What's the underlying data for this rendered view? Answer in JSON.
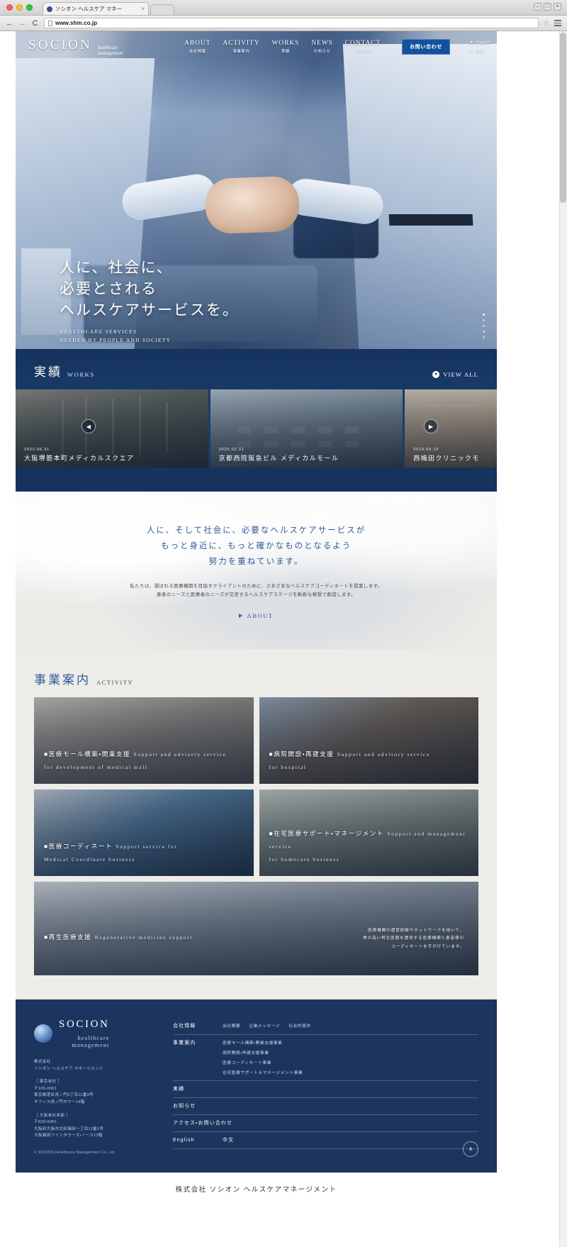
{
  "browser": {
    "tab_title": "ソシオン ヘルスケア マネー",
    "tab_close": "×",
    "url": "www.shm.co.jp",
    "back_icon": "←",
    "forward_icon": "→",
    "reload_icon": "C",
    "star_icon": "☆",
    "minimize": "–",
    "maximize": "□",
    "close": "×"
  },
  "header": {
    "logo_name": "SOCION",
    "logo_sub_line1": "healthcare",
    "logo_sub_line2": "management",
    "nav": [
      {
        "en": "ABOUT",
        "ja": "会社情報"
      },
      {
        "en": "ACTIVITY",
        "ja": "事業案内"
      },
      {
        "en": "WORKS",
        "ja": "実績"
      },
      {
        "en": "NEWS",
        "ja": "お知らせ"
      },
      {
        "en": "CONTACT",
        "ja": "アクセス"
      }
    ],
    "contact_button": "お問い合わせ",
    "lang_en": "English",
    "lang_cn": "中文",
    "lang_arrow": "➤"
  },
  "hero": {
    "line1": "人に、社会に、",
    "line2": "必要とされる",
    "line3": "ヘルスケアサービスを。",
    "en_line1": "HEALTHCARE SERVICES",
    "en_line2": "NEEDED BY PEOPLE AND SOCIETY"
  },
  "works": {
    "title": "実績",
    "subtitle": "WORKS",
    "view_all": "VIEW ALL",
    "prev_icon": "◀",
    "next_icon": "▶",
    "cards": [
      {
        "date": "2022.06.31",
        "title": "大阪堺筋本町メディカルスクエア"
      },
      {
        "date": "2020.02.31",
        "title": "京都西院阪急ビル メディカルモール"
      },
      {
        "date": "2019.09.15",
        "title": "西梅田クリニックモ"
      }
    ]
  },
  "message": {
    "lead_line1": "人に、そして社会に、必要なヘルスケアサービスが",
    "lead_line2": "もっと身近に、もっと確かなものとなるよう",
    "lead_line3": "努力を重ねています。",
    "body_line1": "私たちは、選ばれる医療機関を目指すクライアントのために、さまざまなヘルスケアコーディネートを提案します。",
    "body_line2": "患者のニーズと医療者のニーズが交差するヘルスケアステージを斬新な発想で創造します。",
    "button": "ABOUT"
  },
  "activity": {
    "title": "事業案内",
    "subtitle": "ACTIVITY",
    "cards": [
      {
        "ja": "■医療モール構築・開業支援",
        "en_line1": "Support and advisory service",
        "en_line2": "for development of medical mall"
      },
      {
        "ja": "■病院開設・再建支援",
        "en_line1": "Support and advisory service",
        "en_line2": "for hospital"
      },
      {
        "ja": "■医療コーディネート",
        "en_line1": "Support service for",
        "en_line2": "Medical Coordinate business"
      },
      {
        "ja": "■在宅医療サポート・マネージメント",
        "en_line1": "Support and management service",
        "en_line2": "for homecare business"
      },
      {
        "ja": "■再生医療支援",
        "en_line1": "Regenerative medicine support",
        "en_line2": "",
        "side_line1": "医療機関の運営経験やネットワークを用いて、",
        "side_line2": "質の高い再生医療を提供する医療機関と患者様の",
        "side_line3": "コーディネートを手がけています。"
      }
    ]
  },
  "footer": {
    "logo_name": "SOCION",
    "logo_sub_line1": "healthcare",
    "logo_sub_line2": "management",
    "company_line1": "株式会社",
    "company_line2": "ソシオン ヘルスケア マネージメント",
    "tokyo_label": "［ 東京本社 ］",
    "tokyo_zip": "〒105-0001",
    "tokyo_addr1": "東京都港区虎ノ門3丁目11番3号",
    "tokyo_addr2": "オフィス虎ノ門タワー14階",
    "osaka_label": "［ 大阪本社本部 ］",
    "osaka_zip": "〒530-0001",
    "osaka_addr1": "大阪府大阪市北区梅田一丁目11番1号",
    "osaka_addr2": "大阪梅田ツインタワーズ・ノース13階",
    "copyright": "© SOCION Healthcare Management Co.,Ltd",
    "to_top_icon": "∧",
    "rows": [
      {
        "category": "会社情報",
        "links": [
          "会社概要",
          "企業メッセージ",
          "社会的使命"
        ]
      },
      {
        "category": "事業案内",
        "links": [
          "医療モール構築・開業支援事業",
          "病院開設・再建支援事業",
          "医療コーディネート事業",
          "在宅医療サポート＆マネージメント事業"
        ]
      }
    ],
    "single_rows": [
      "実績",
      "お知らせ",
      "アクセス・お問い合わせ"
    ],
    "lang_row": [
      "English",
      "中文"
    ]
  },
  "page_bottom": {
    "caption": "株式会社 ソシオン ヘルスケアマネージメント"
  }
}
